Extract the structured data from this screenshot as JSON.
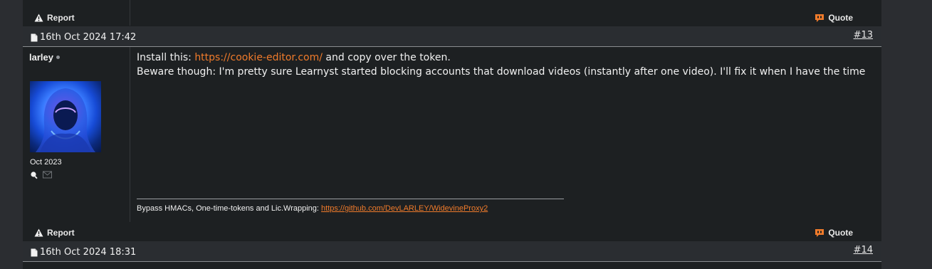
{
  "actions": {
    "report_label": "Report",
    "quote_label": "Quote"
  },
  "posts": [
    {
      "number": "#13",
      "date": "16th Oct 2024 17:42",
      "author": {
        "username": "larley",
        "join_date": "Oct 2023"
      },
      "body": {
        "line1_prefix": "Install this:",
        "link_text": "https://cookie-editor.com/",
        "line1_suffix": "and copy over the token.",
        "line2": "Beware though: I'm pretty sure Learnyst started blocking accounts that download videos (instantly after one video). I'll fix it when I have the time"
      },
      "signature": {
        "text": "Bypass HMACs, One-time-tokens and Lic.Wrapping:",
        "link_text": "https://github.com/DevLARLEY/WidevineProxy2"
      }
    },
    {
      "number": "#14",
      "date": "16th Oct 2024 18:31"
    }
  ],
  "colors": {
    "page_bg": "#2b2d31",
    "post_bg": "#1d2022",
    "header_bg": "#2a2d31",
    "link": "#f07b2b",
    "quote_icon": "#f07b2b"
  },
  "icons": {
    "report": "warning-triangle-icon",
    "quote": "quote-bubble-icon",
    "post": "document-icon",
    "search": "magnifier-icon",
    "mail": "envelope-icon"
  }
}
